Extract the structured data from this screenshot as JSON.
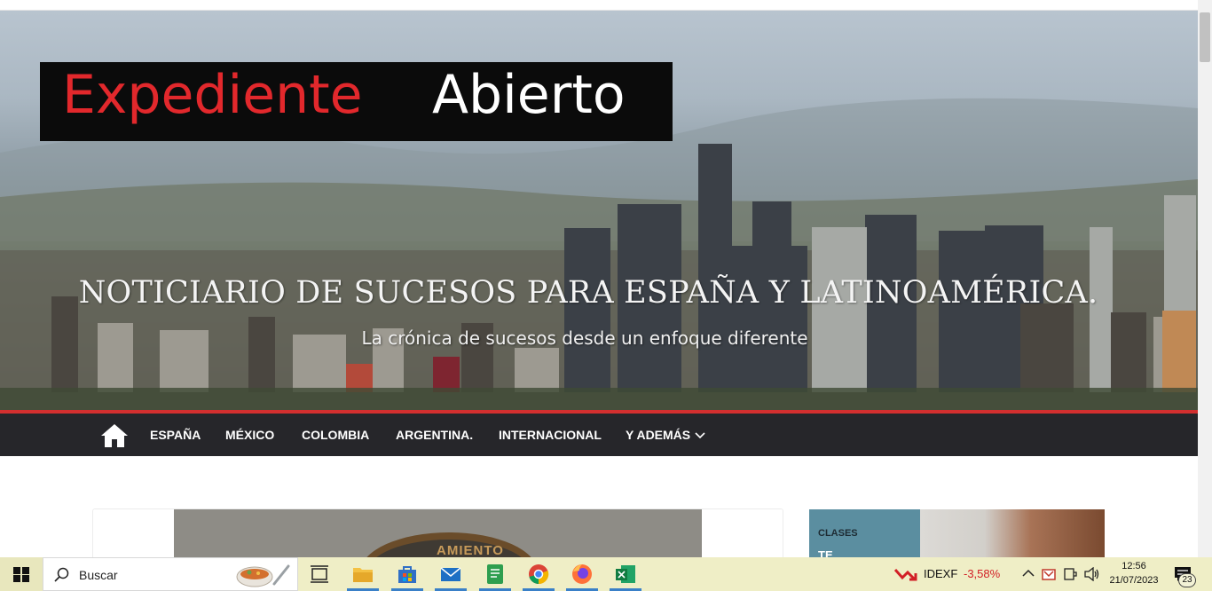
{
  "header": {
    "logo_red": "Expediente",
    "logo_white": "Abierto",
    "title": "NOTICIARIO DE SUCESOS PARA ESPAÑA Y LATINOAMÉRICA.",
    "subtitle": "La crónica de sucesos desde un enfoque diferente"
  },
  "nav": {
    "home_icon": "home-icon",
    "items": [
      "ESPAÑA",
      "MÉXICO",
      "COLOMBIA",
      "ARGENTINA.",
      "INTERNACIONAL",
      "Y ADEMÁS"
    ]
  },
  "article": {
    "image_text": "AMIENTO"
  },
  "ad": {
    "label": "CLASES",
    "headline": "TE"
  },
  "taskbar": {
    "search_placeholder": "Buscar",
    "stock_ticker": "IDEXF",
    "stock_change": "-3,58%",
    "time": "12:56",
    "date": "21/07/2023",
    "notification_count": "23"
  },
  "colors": {
    "accent_red": "#d32f2f",
    "nav_background": "#26262a",
    "logo_red": "#e2282c",
    "taskbar_background": "#efeec6"
  }
}
